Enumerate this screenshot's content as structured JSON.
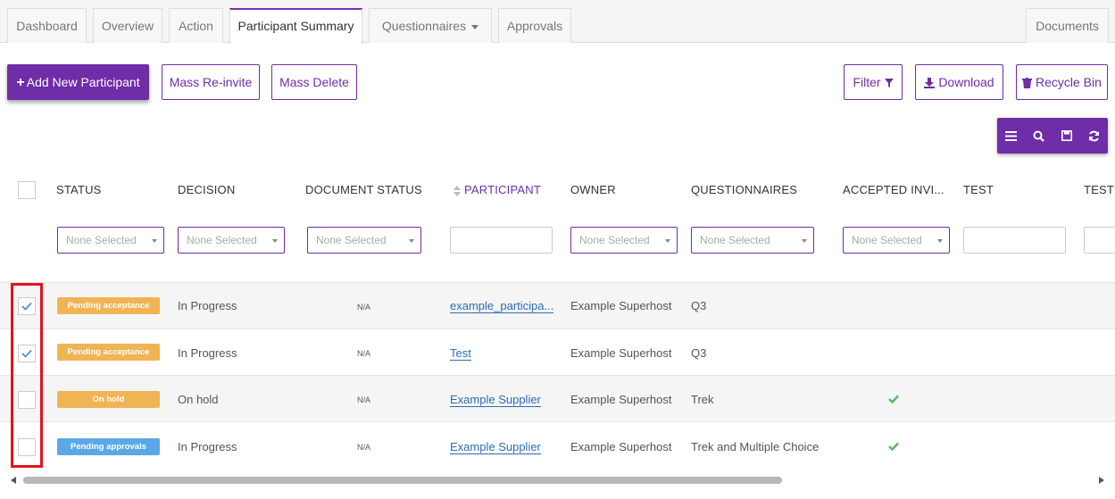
{
  "tabs": [
    {
      "label": "Dashboard"
    },
    {
      "label": "Overview"
    },
    {
      "label": "Action"
    },
    {
      "label": "Participant Summary"
    },
    {
      "label": "Questionnaires"
    },
    {
      "label": "Approvals"
    },
    {
      "label": "Documents"
    }
  ],
  "actions": {
    "add_participant": "Add New Participant",
    "mass_reinvite": "Mass Re-invite",
    "mass_delete": "Mass Delete",
    "filter": "Filter",
    "download": "Download",
    "recycle_bin": "Recycle Bin"
  },
  "columns": [
    "STATUS",
    "DECISION",
    "DOCUMENT STATUS",
    "PARTICIPANT",
    "OWNER",
    "QUESTIONNAIRES",
    "ACCEPTED INVI...",
    "TEST",
    "TEST"
  ],
  "filter_placeholder": "None Selected",
  "rows": [
    {
      "status": "Pending acceptance",
      "decision": "In Progress",
      "document_status": "N/A",
      "participant": "example_participa...",
      "owner": "Example Superhost",
      "questionnaires": "Q3",
      "accepted": false,
      "checked": true
    },
    {
      "status": "Pending acceptance",
      "decision": "In Progress",
      "document_status": "N/A",
      "participant": "Test",
      "owner": "Example Superhost",
      "questionnaires": "Q3",
      "accepted": false,
      "checked": true
    },
    {
      "status": "On hold",
      "decision": "On hold",
      "document_status": "N/A",
      "participant": "Example Supplier",
      "owner": "Example Superhost",
      "questionnaires": "Trek",
      "accepted": true,
      "checked": false
    },
    {
      "status": "Pending approvals",
      "decision": "In Progress",
      "document_status": "N/A",
      "participant": "Example Supplier",
      "owner": "Example Superhost",
      "questionnaires": "Trek and Multiple Choice",
      "accepted": true,
      "checked": false
    }
  ],
  "colors": {
    "accent": "#6f2da8",
    "badge_pending_acceptance": "#f0b455",
    "badge_on_hold": "#f0b455",
    "badge_pending_approvals": "#5aa9e6",
    "check_green": "#5cb85c",
    "highlight_red": "#e0141e"
  }
}
